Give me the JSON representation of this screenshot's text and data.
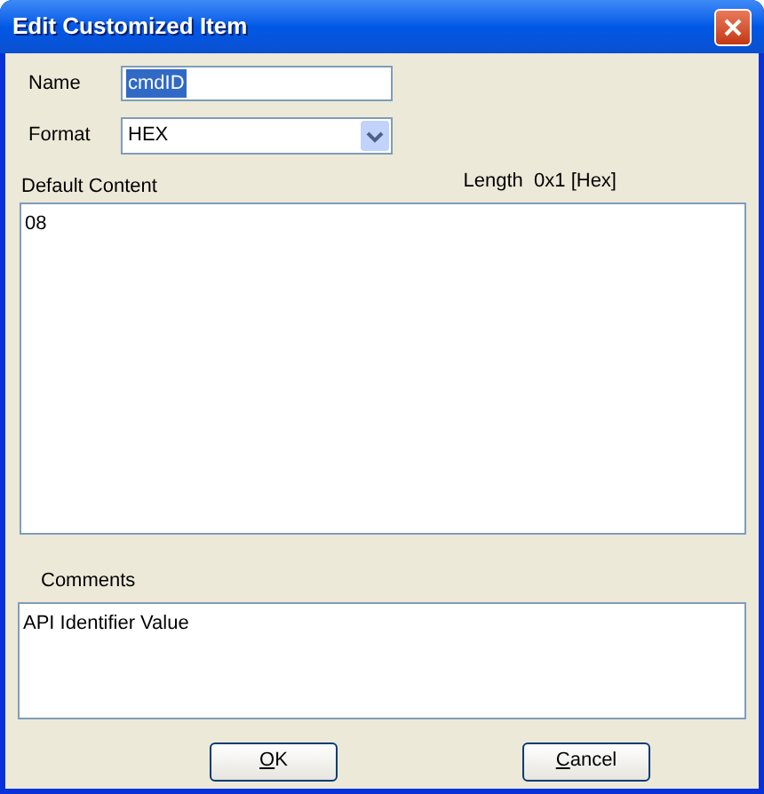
{
  "window": {
    "title": "Edit Customized Item"
  },
  "name_field": {
    "label": "Name",
    "value": "cmdID",
    "selected": true
  },
  "format_field": {
    "label": "Format",
    "value": "HEX"
  },
  "default_content": {
    "label": "Default Content",
    "length": "Length  0x1 [Hex]",
    "value": "08"
  },
  "comments": {
    "label": "Comments",
    "value": "API Identifier Value"
  },
  "buttons": [
    {
      "access_key": "O",
      "label_rest": "K"
    },
    {
      "access_key": "C",
      "label_rest": "ancel"
    }
  ]
}
